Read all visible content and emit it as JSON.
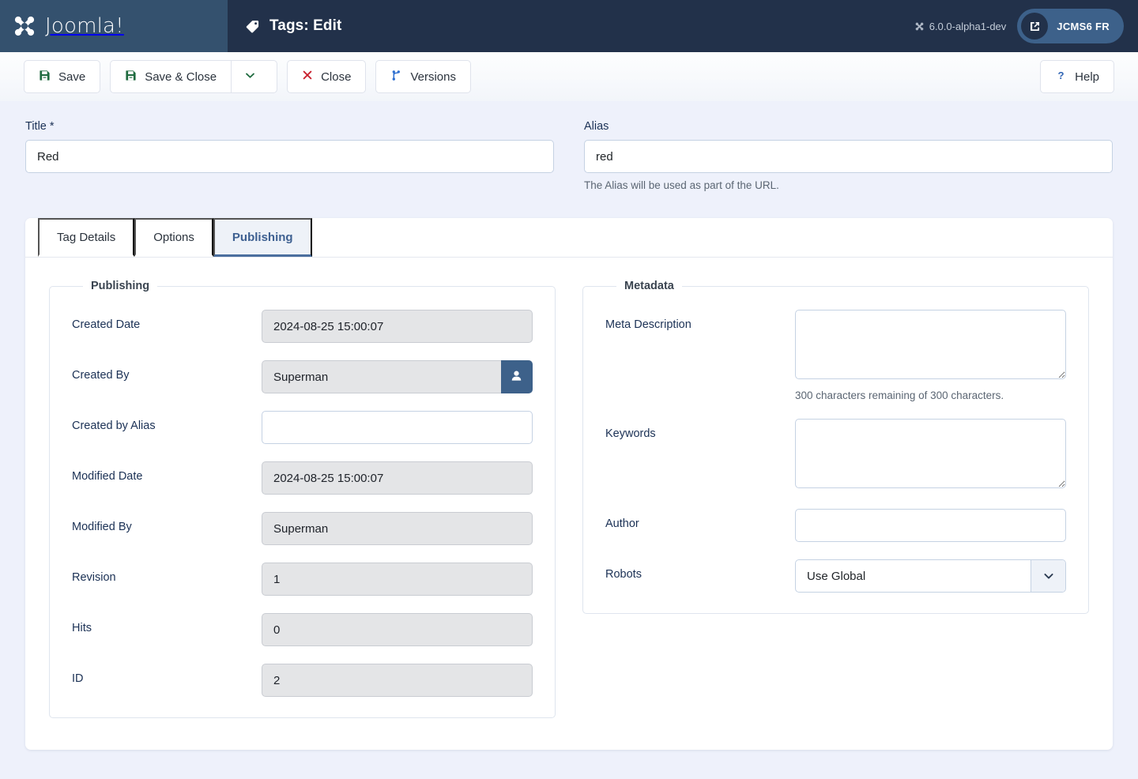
{
  "header": {
    "brand": "Joomla!",
    "page_icon": "tag-icon",
    "title": "Tags: Edit",
    "version": "6.0.0-alpha1-dev",
    "site_button_label": "JCMS6 FR"
  },
  "toolbar": {
    "save_label": "Save",
    "save_close_label": "Save & Close",
    "save_close_caret_label": "",
    "close_label": "Close",
    "versions_label": "Versions",
    "help_label": "Help"
  },
  "form": {
    "title_label": "Title *",
    "title_value": "Red",
    "title_placeholder": "",
    "alias_label": "Alias",
    "alias_value": "red",
    "alias_placeholder": "",
    "alias_help": "The Alias will be used as part of the URL."
  },
  "tabs": [
    {
      "label": "Tag Details",
      "active": false
    },
    {
      "label": "Options",
      "active": false
    },
    {
      "label": "Publishing",
      "active": true
    }
  ],
  "publishing": {
    "legend": "Publishing",
    "fields": [
      {
        "label": "Created Date",
        "value": "2024-08-25 15:00:07",
        "disabled": true
      },
      {
        "label": "Created By",
        "value": "Superman",
        "disabled": true
      },
      {
        "label": "Created by Alias",
        "value": "",
        "disabled": false
      },
      {
        "label": "Modified Date",
        "value": "2024-08-25 15:00:07",
        "disabled": true
      },
      {
        "label": "Modified By",
        "value": "Superman",
        "disabled": true
      },
      {
        "label": "Revision",
        "value": "1",
        "disabled": true
      },
      {
        "label": "Hits",
        "value": "0",
        "disabled": true
      },
      {
        "label": "ID",
        "value": "2",
        "disabled": true
      }
    ],
    "user_select_icon": "user-icon"
  },
  "metadata": {
    "legend": "Metadata",
    "meta_description_label": "Meta Description",
    "meta_description_value": "",
    "meta_description_counter": "300 characters remaining of 300 characters.",
    "keywords_label": "Keywords",
    "keywords_value": "",
    "author_label": "Author",
    "author_value": "",
    "robots_label": "Robots",
    "robots_value": "Use Global",
    "robots_options": [
      "Use Global"
    ]
  },
  "colors": {
    "header_bg": "#22314a",
    "brand_bg": "#34516e",
    "body_bg": "#eef1fb",
    "accent": "#3d618a",
    "save_icon": "#1f6b3f",
    "close_icon": "#c8202d",
    "versions_icon": "#2f6fd0",
    "help_icon": "#3266b5",
    "tab_active": "#4b6f9e"
  }
}
